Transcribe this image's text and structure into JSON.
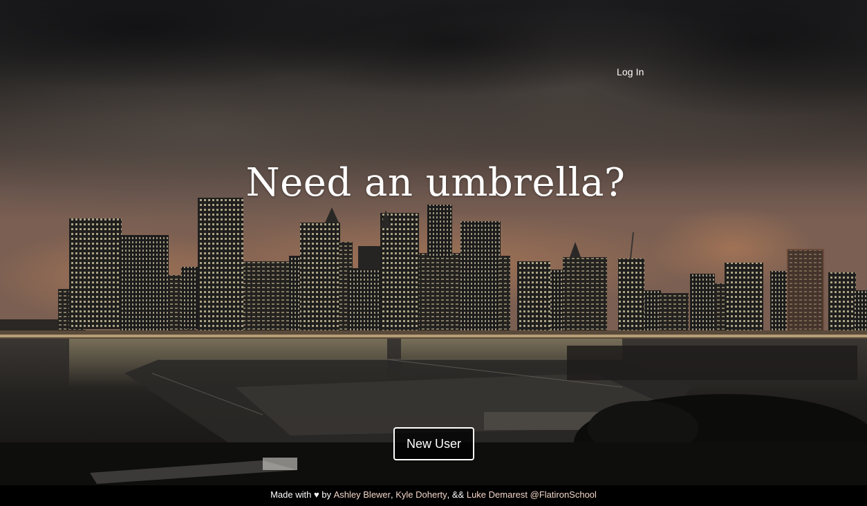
{
  "nav": {
    "login_label": "Log In"
  },
  "hero": {
    "headline": "Need an umbrella?",
    "new_user_label": "New User"
  },
  "footer": {
    "prefix": "Made with ",
    "heart": "♥",
    "by": " by ",
    "author_1": "Ashley Blewer",
    "separator_1": ", ",
    "author_2": "Kyle Doherty",
    "separator_2": ", && ",
    "author_3": "Luke Demarest",
    "space": " ",
    "org": "@FlatironSchool"
  },
  "colors": {
    "text": "#ffffff",
    "link": "#f3d6c9",
    "footer_bg": "#000000",
    "button_bg": "#000000"
  }
}
